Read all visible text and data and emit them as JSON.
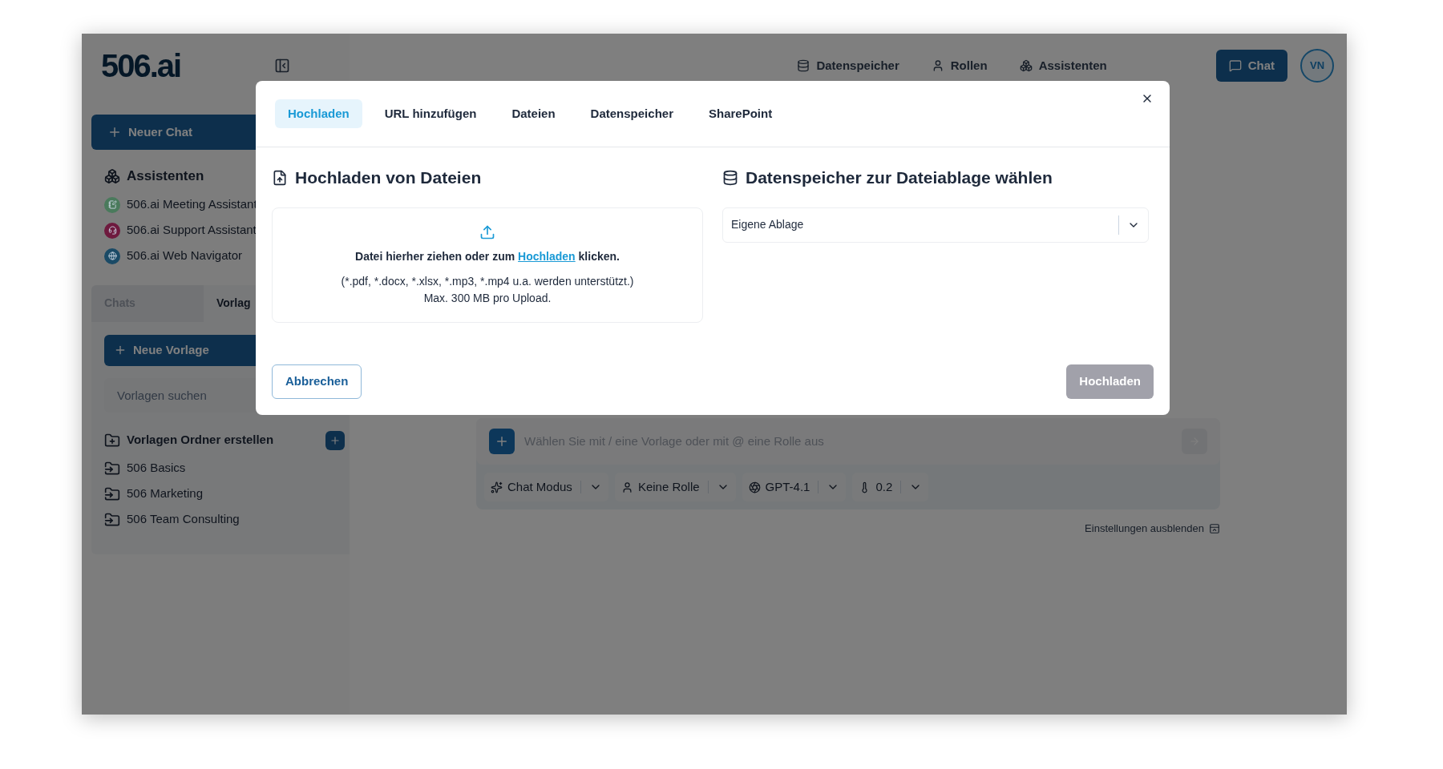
{
  "sidebar": {
    "logo": "506.ai",
    "new_chat": "Neuer Chat",
    "assistants_heading": "Assistenten",
    "assistants": [
      {
        "name": "506.ai Meeting Assistant",
        "kind": "notes",
        "color": "#4a7a5c"
      },
      {
        "name": "506.ai Support Assistant",
        "kind": "support",
        "color": "#6e1a3e"
      },
      {
        "name": "506.ai Web Navigator",
        "kind": "web",
        "color": "#1a4a66"
      }
    ],
    "tabs": [
      {
        "label": "Chats",
        "selected": false
      },
      {
        "label": "Vorlag",
        "selected": true
      }
    ],
    "new_template": "Neue Vorlage",
    "search": {
      "placeholder": "Vorlagen suchen"
    },
    "folder_create": "Vorlagen Ordner erstellen",
    "folders": [
      "506 Basics",
      "506 Marketing",
      "506 Team Consulting"
    ]
  },
  "topbar": {
    "nav": [
      {
        "label": "Datenspeicher",
        "kind": "storage"
      },
      {
        "label": "Rollen",
        "kind": "roles"
      },
      {
        "label": "Assistenten",
        "kind": "assistants"
      }
    ],
    "chat_button": "Chat",
    "avatar": "VN"
  },
  "composer": {
    "placeholder": "Wählen Sie mit / eine Vorlage oder mit @ eine Rolle aus",
    "chips": [
      {
        "label": "Chat Modus",
        "kind": "mode"
      },
      {
        "label": "Keine Rolle",
        "kind": "role"
      },
      {
        "label": "GPT-4.1",
        "kind": "model"
      },
      {
        "label": "0.2",
        "kind": "temperature"
      }
    ],
    "hide_settings": "Einstellungen ausblenden"
  },
  "dialog": {
    "tabs": [
      {
        "label": "Hochladen",
        "selected": true
      },
      {
        "label": "URL hinzufügen",
        "selected": false
      },
      {
        "label": "Dateien",
        "selected": false
      },
      {
        "label": "Datenspeicher",
        "selected": false
      },
      {
        "label": "SharePoint",
        "selected": false
      }
    ],
    "upload": {
      "title": "Hochladen von Dateien",
      "prompt_before": "Datei hierher ziehen oder zum",
      "link": "Hochladen",
      "prompt_after": "klicken.",
      "formats": "(*.pdf, *.docx, *.xlsx, *.mp3, *.mp4 u.a. werden unterstützt.)",
      "limit": "Max. 300 MB pro Upload."
    },
    "storage": {
      "title": "Datenspeicher zur Dateiablage wählen",
      "value": "Eigene Ablage"
    },
    "cancel": "Abbrechen",
    "submit": {
      "label": "Hochladen",
      "disabled": true
    }
  }
}
